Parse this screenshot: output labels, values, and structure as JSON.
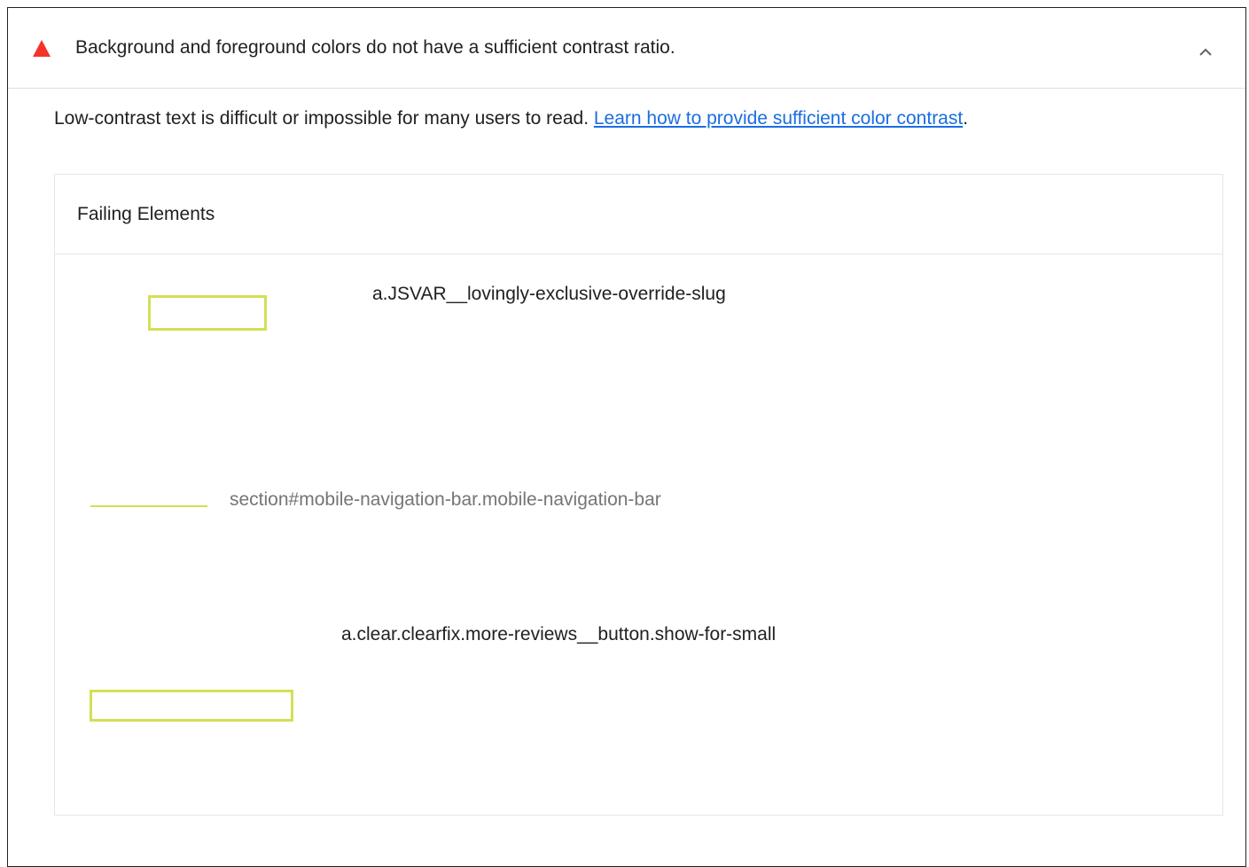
{
  "audit": {
    "title": "Background and foreground colors do not have a sufficient contrast ratio.",
    "status": "fail",
    "status_color": "#f4342a",
    "expanded": true,
    "description": {
      "text": "Low-contrast text is difficult or impossible for many users to read. ",
      "link_label": "Learn how to provide sufficient color contrast",
      "suffix": "."
    }
  },
  "table": {
    "header": "Failing Elements",
    "highlight_color": "#d4df56",
    "rows": [
      {
        "selector": "a.JSVAR__lovingly-exclusive-override-slug"
      },
      {
        "selector": "section#mobile-navigation-bar.mobile-navigation-bar"
      },
      {
        "selector": "a.clear.clearfix.more-reviews__button.show-for-small"
      }
    ]
  },
  "colors": {
    "link": "#1a6ee0",
    "text": "#202124",
    "muted_text": "#757575"
  }
}
